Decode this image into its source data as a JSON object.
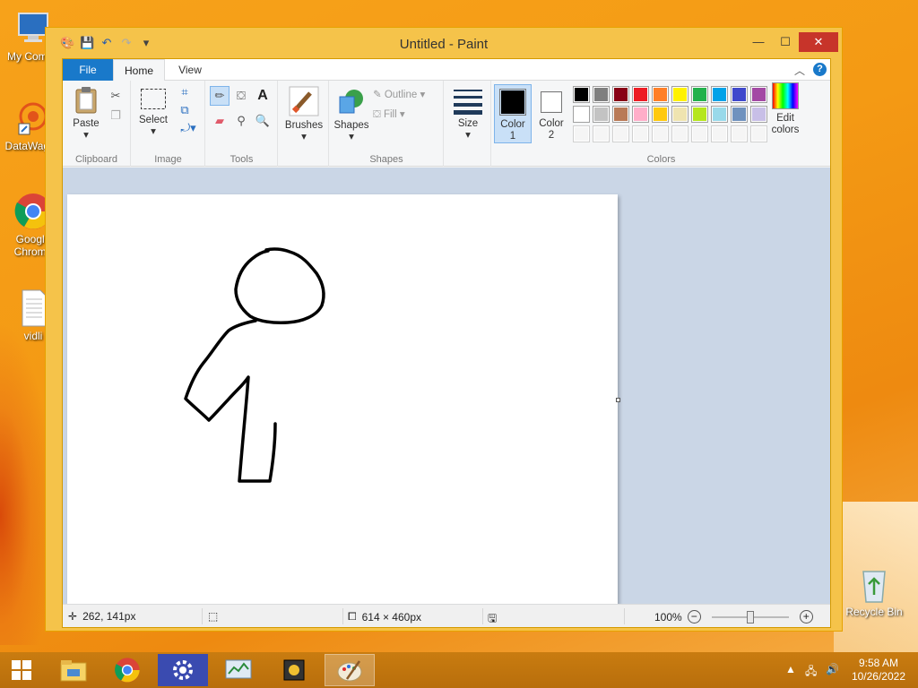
{
  "desktop": {
    "icons": [
      {
        "label": "My Compu",
        "icon": "computer-icon"
      },
      {
        "label": "DataWagon",
        "icon": "datawagon-icon"
      },
      {
        "label": "Google Chrome",
        "icon": "chrome-icon"
      },
      {
        "label": "vidli",
        "icon": "text-file-icon"
      },
      {
        "label": "Recycle Bin",
        "icon": "recycle-bin-icon"
      }
    ]
  },
  "window": {
    "title": "Untitled - Paint",
    "controls": {
      "minimize": "—",
      "maximize": "☐",
      "close": "✕"
    }
  },
  "ribbon": {
    "tabs": [
      "File",
      "Home",
      "View"
    ],
    "clipboard": {
      "paste": "Paste",
      "group": "Clipboard"
    },
    "image": {
      "select": "Select",
      "group": "Image"
    },
    "tools": {
      "group": "Tools",
      "text_tool": "A"
    },
    "brushes": {
      "label": "Brushes"
    },
    "shapes": {
      "label": "Shapes",
      "outline": "Outline",
      "fill": "Fill",
      "group": "Shapes"
    },
    "size": {
      "label": "Size"
    },
    "color1": {
      "line1": "Color",
      "line2": "1",
      "value": "#000000"
    },
    "color2": {
      "line1": "Color",
      "line2": "2",
      "value": "#ffffff"
    },
    "colors": {
      "group": "Colors",
      "row1": [
        "#000000",
        "#7f7f7f",
        "#880015",
        "#ed1c24",
        "#ff7f27",
        "#fff200",
        "#22b14c",
        "#00a2e8",
        "#3f48cc",
        "#a349a4"
      ],
      "row2": [
        "#ffffff",
        "#c3c3c3",
        "#b97a57",
        "#ffaec9",
        "#ffc90e",
        "#efe4b0",
        "#b5e61d",
        "#99d9ea",
        "#7092be",
        "#c8bfe7"
      ],
      "row3": [
        "#f5f5f5",
        "#f5f5f5",
        "#f5f5f5",
        "#f5f5f5",
        "#f5f5f5",
        "#f5f5f5",
        "#f5f5f5",
        "#f5f5f5",
        "#f5f5f5",
        "#f5f5f5"
      ],
      "edit_line1": "Edit",
      "edit_line2": "colors"
    }
  },
  "status": {
    "cursor_pos": "262, 141px",
    "canvas_size": "614 × 460px",
    "zoom": "100%",
    "zoom_fraction": 0.5
  },
  "taskbar": {
    "time": "9:58 AM",
    "date": "10/26/2022",
    "apps": [
      "file-explorer-icon",
      "chrome-icon",
      "settings-icon",
      "task-manager-icon",
      "app-icon",
      "paint-icon"
    ]
  }
}
